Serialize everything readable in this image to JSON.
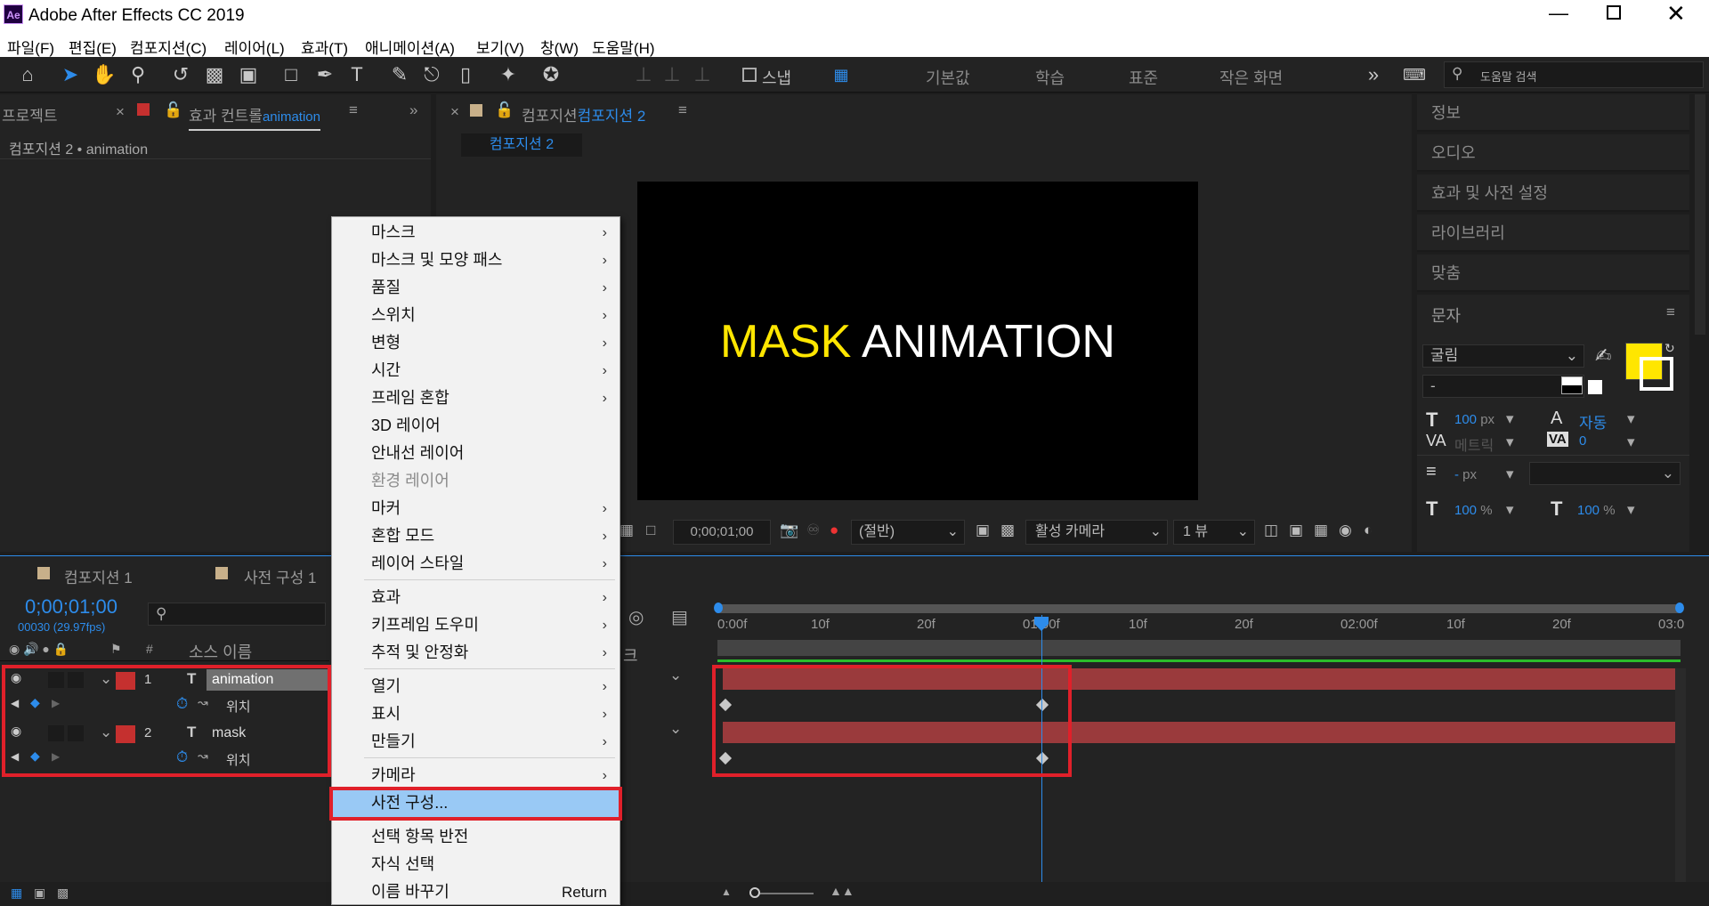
{
  "app": {
    "title": "Adobe After Effects CC 2019",
    "icon": "Ae"
  },
  "menubar": [
    "파일(F)",
    "편집(E)",
    "컴포지션(C)",
    "레이어(L)",
    "효과(T)",
    "애니메이션(A)",
    "보기(V)",
    "창(W)",
    "도움말(H)"
  ],
  "toolbar": {
    "snap_label": "스냅",
    "workspaces": [
      "기본값",
      "학습",
      "표준",
      "작은 화면"
    ],
    "search_placeholder": "도움말 검색"
  },
  "project_panel": {
    "tab_project": "프로젝트",
    "tab_effects_prefix": "효과 컨트롤",
    "tab_effects_layer": "animation",
    "header": "컴포지션 2 • animation"
  },
  "comp_panel": {
    "tab_prefix": "컴포지션",
    "tab_name": "컴포지션 2",
    "subtab": "컴포지션 2",
    "preview_word1": "MASK",
    "preview_word2": "ANIMATION",
    "timecode": "0;00;01;00",
    "resolution": "(절반)",
    "camera": "활성 카메라",
    "views": "1 뷰"
  },
  "right_panel": {
    "items": [
      "정보",
      "오디오",
      "효과 및 사전 설정",
      "라이브러리",
      "맞춤",
      "문자"
    ],
    "font_name": "굴림",
    "font_style": "-",
    "font_size": "100",
    "font_size_unit": "px",
    "leading": "자동",
    "kerning": "메트릭",
    "tracking": "0",
    "stroke_width": "-",
    "stroke_unit": "px",
    "vscale": "100",
    "hscale": "100",
    "percent": "%",
    "fill_color": "#ffe600"
  },
  "timeline": {
    "tabs": [
      "컴포지션 1",
      "사전 구성 1"
    ],
    "timecode": "0;00;01;00",
    "frame_info": "00030 (29.97fps)",
    "col_hash": "#",
    "col_source": "소스 이름",
    "col_parent": "크",
    "layers": [
      {
        "num": "1",
        "name": "animation",
        "prop": "위치"
      },
      {
        "num": "2",
        "name": "mask",
        "prop": "위치"
      }
    ],
    "ruler": [
      "0:00f",
      "10f",
      "20f",
      "01:00f",
      "10f",
      "20f",
      "02:00f",
      "10f",
      "20f",
      "03:0"
    ]
  },
  "context_menu": {
    "items": [
      {
        "label": "마스크",
        "sub": true
      },
      {
        "label": "마스크 및 모양 패스",
        "sub": true
      },
      {
        "label": "품질",
        "sub": true
      },
      {
        "label": "스위치",
        "sub": true
      },
      {
        "label": "변형",
        "sub": true
      },
      {
        "label": "시간",
        "sub": true
      },
      {
        "label": "프레임 혼합",
        "sub": true
      },
      {
        "label": "3D 레이어",
        "sub": false
      },
      {
        "label": "안내선 레이어",
        "sub": false
      },
      {
        "label": "환경 레이어",
        "sub": false,
        "disabled": true
      },
      {
        "label": "마커",
        "sub": true
      },
      {
        "label": "혼합 모드",
        "sub": true
      },
      {
        "label": "레이어 스타일",
        "sub": true
      },
      {
        "label": "효과",
        "sub": true
      },
      {
        "label": "키프레임 도우미",
        "sub": true
      },
      {
        "label": "추적 및 안정화",
        "sub": true
      },
      {
        "label": "열기",
        "sub": true
      },
      {
        "label": "표시",
        "sub": true
      },
      {
        "label": "만들기",
        "sub": true
      },
      {
        "label": "카메라",
        "sub": true
      },
      {
        "label": "사전 구성...",
        "sub": false,
        "highlighted": true
      },
      {
        "label": "선택 항목 반전",
        "sub": false
      },
      {
        "label": "자식 선택",
        "sub": false
      },
      {
        "label": "이름 바꾸기",
        "sub": false,
        "shortcut": "Return"
      }
    ]
  },
  "colors": {
    "accent": "#2d8ceb",
    "highlight": "#99c9f5",
    "annotation_red": "#e0202a",
    "text_yellow": "#ffe600",
    "layer_bar": "#9a3a3c"
  }
}
